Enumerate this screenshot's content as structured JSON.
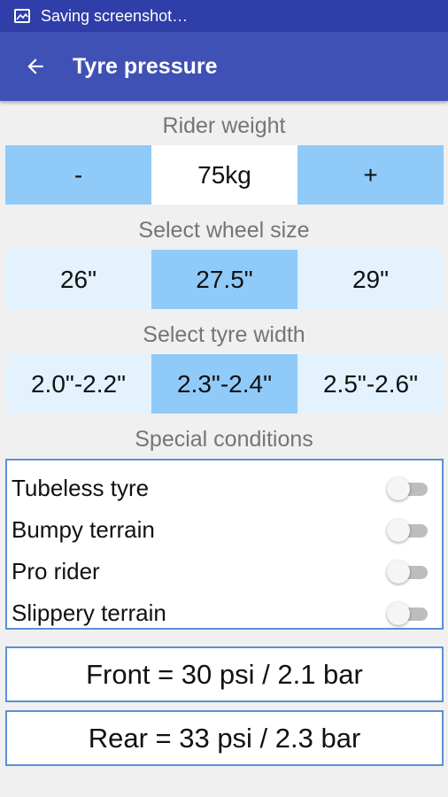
{
  "status_bar": {
    "text": "Saving screenshot…",
    "icon": "screenshot-icon"
  },
  "app_bar": {
    "title": "Tyre pressure",
    "back_icon": "arrow-back-icon"
  },
  "rider_weight": {
    "label": "Rider weight",
    "decrement": "-",
    "value": "75kg",
    "increment": "+"
  },
  "wheel_size": {
    "label": "Select wheel size",
    "options": [
      "26\"",
      "27.5\"",
      "29\""
    ],
    "selected": "27.5\""
  },
  "tyre_width": {
    "label": "Select tyre width",
    "options": [
      "2.0\"-2.2\"",
      "2.3\"-2.4\"",
      "2.5\"-2.6\""
    ],
    "selected": "2.3\"-2.4\""
  },
  "special_conditions": {
    "label": "Special conditions",
    "items": [
      {
        "label": "Tubeless tyre",
        "on": false
      },
      {
        "label": "Bumpy terrain",
        "on": false
      },
      {
        "label": "Pro rider",
        "on": false
      },
      {
        "label": "Slippery terrain",
        "on": false
      }
    ]
  },
  "results": {
    "front": "Front = 30 psi / 2.1 bar",
    "rear": "Rear = 33 psi / 2.3 bar"
  },
  "colors": {
    "status_bar": "#2f3ea8",
    "app_bar": "#3f51b5",
    "selected_segment": "#90caf9",
    "unselected_segment": "#e3f2fd",
    "box_border": "#5c8fd6"
  }
}
